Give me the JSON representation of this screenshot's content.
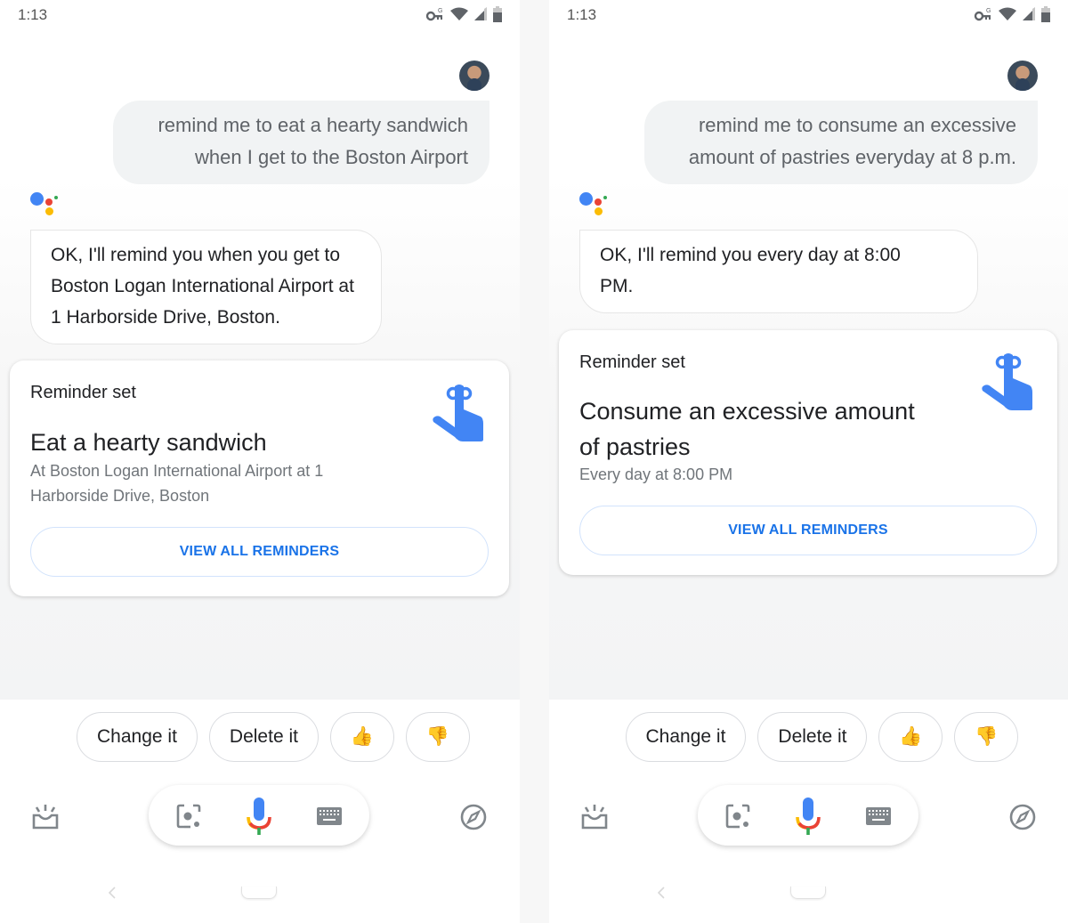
{
  "colors": {
    "accent_blue": "#1a73e8",
    "hand_blue": "#4285f4",
    "google_red": "#ea4335",
    "google_yellow": "#fbbc04",
    "google_green": "#34a853"
  },
  "screens": [
    {
      "status_bar": {
        "time": "1:13",
        "icons": [
          "vpn-key-icon",
          "wifi-icon",
          "signal-icon",
          "battery-icon"
        ]
      },
      "user_query": {
        "lines": [
          "remind me to eat a hearty sandwich",
          "when I get to the Boston Airport"
        ]
      },
      "assistant_reply": {
        "lines": [
          "OK, I'll remind you when you get to",
          "Boston Logan International Airport at",
          "1 Harborside Drive, Boston."
        ]
      },
      "reminder_card": {
        "label": "Reminder set",
        "title_lines": [
          "Eat a hearty sandwich"
        ],
        "subtitle_lines": [
          "At Boston Logan International Airport at 1",
          "Harborside Drive, Boston"
        ],
        "button_label": "VIEW ALL REMINDERS",
        "icon": "reminder-finger-icon"
      },
      "suggestion_chips": [
        {
          "label": "Change it"
        },
        {
          "label": "Delete it"
        },
        {
          "label": "👍"
        },
        {
          "label": "👎"
        }
      ],
      "bottom_bar": {
        "left_icon": "updates-tray-icon",
        "center_icons": [
          "lens-icon",
          "mic-icon",
          "keyboard-icon"
        ],
        "right_icon": "explore-compass-icon"
      }
    },
    {
      "status_bar": {
        "time": "1:13",
        "icons": [
          "vpn-key-icon",
          "wifi-icon",
          "signal-icon",
          "battery-icon"
        ]
      },
      "user_query": {
        "lines": [
          "remind me to consume an excessive",
          "amount of pastries everyday at 8 p.m."
        ]
      },
      "assistant_reply": {
        "lines": [
          "OK, I'll remind you every day at 8:00",
          "PM."
        ]
      },
      "reminder_card": {
        "label": "Reminder set",
        "title_lines": [
          "Consume an excessive amount",
          "of pastries"
        ],
        "subtitle_lines": [
          "Every day at 8:00 PM"
        ],
        "button_label": "VIEW ALL REMINDERS",
        "icon": "reminder-finger-icon"
      },
      "suggestion_chips": [
        {
          "label": "Change it"
        },
        {
          "label": "Delete it"
        },
        {
          "label": "👍"
        },
        {
          "label": "👎"
        }
      ],
      "bottom_bar": {
        "left_icon": "updates-tray-icon",
        "center_icons": [
          "lens-icon",
          "mic-icon",
          "keyboard-icon"
        ],
        "right_icon": "explore-compass-icon"
      }
    }
  ]
}
